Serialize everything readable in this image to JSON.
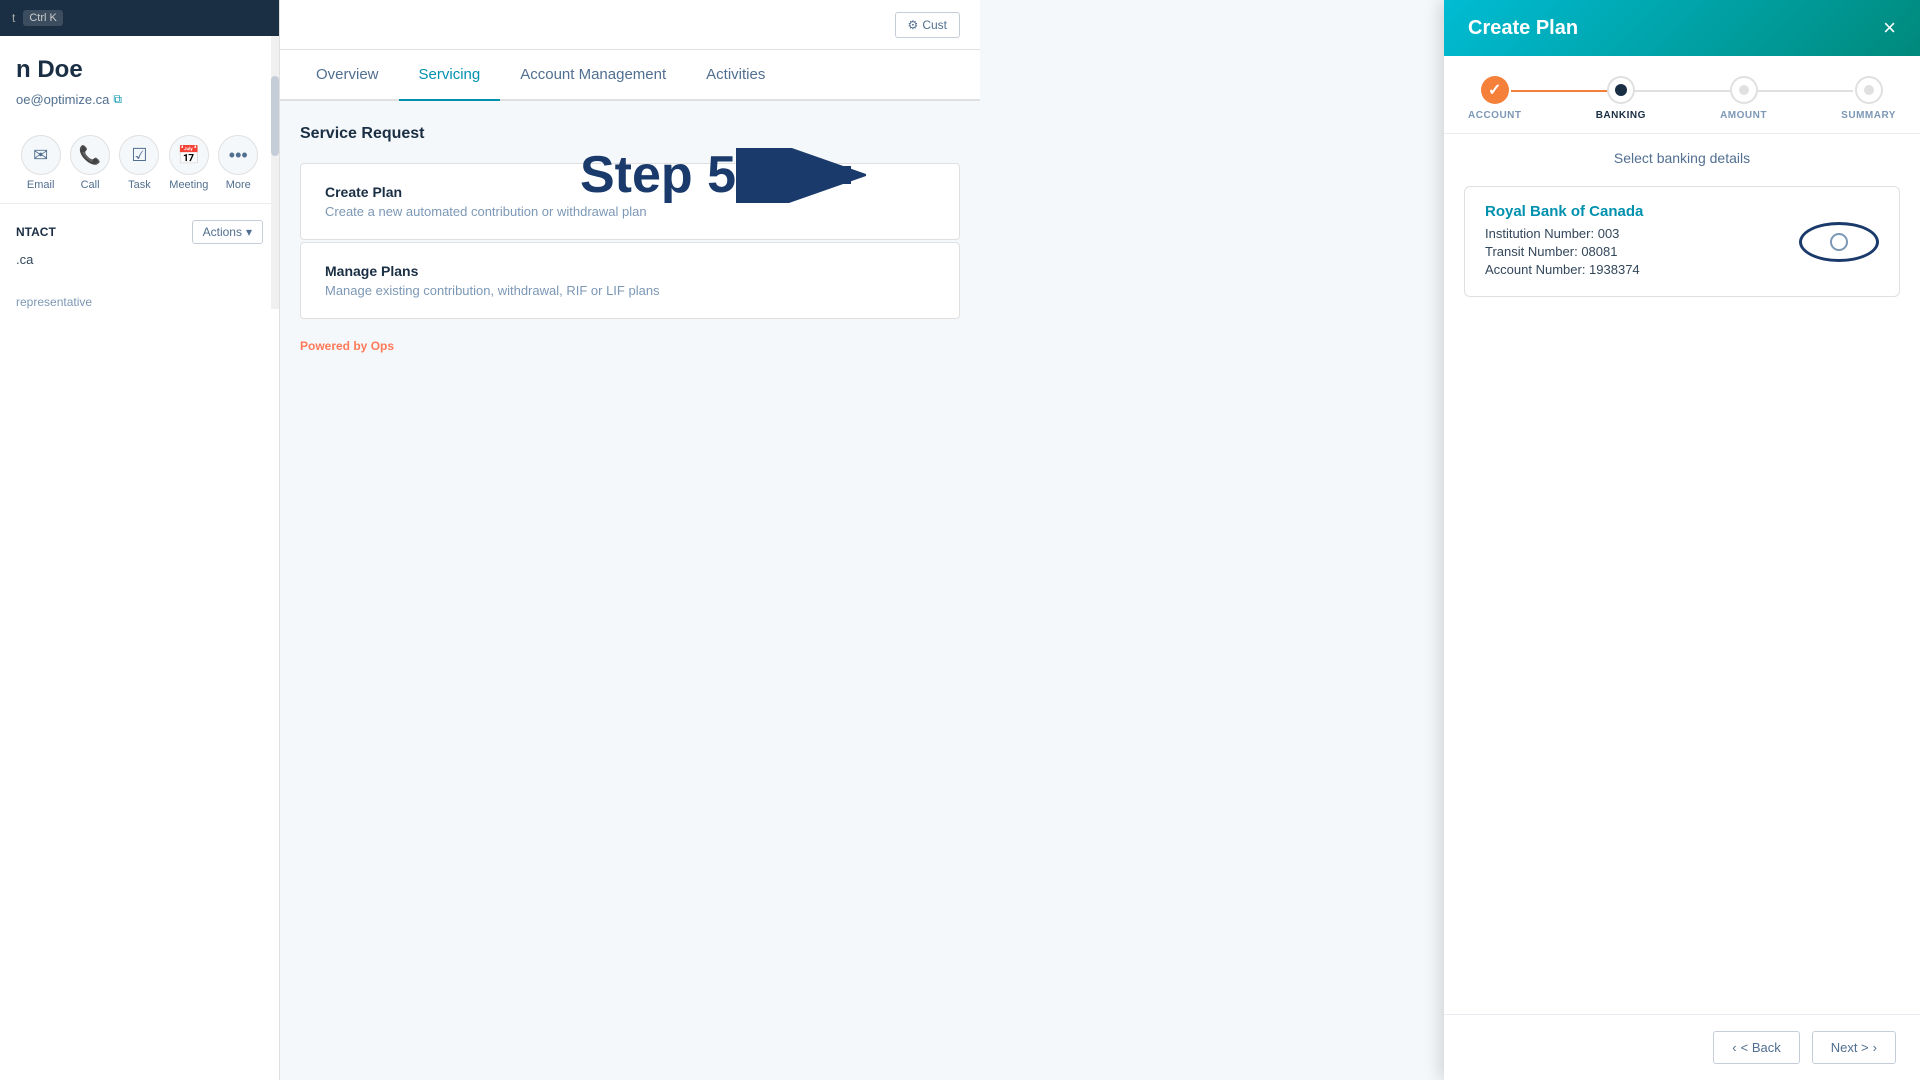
{
  "sidebar": {
    "search_hint": "Ctrl K",
    "contact_name": "n Doe",
    "contact_email": "oe@optimize.ca",
    "actions_label": "Actions",
    "action_icons": [
      {
        "id": "email",
        "icon": "✉",
        "label": "Email"
      },
      {
        "id": "call",
        "icon": "📞",
        "label": "Call"
      },
      {
        "id": "task",
        "icon": "📋",
        "label": "Task"
      },
      {
        "id": "meeting",
        "icon": "📅",
        "label": "Meeting"
      },
      {
        "id": "more",
        "icon": "•••",
        "label": "More"
      }
    ],
    "contact_section_title": "ntact",
    "contact_actions_btn": "Actions",
    "field1": ".ca",
    "rep_label": "representative"
  },
  "main": {
    "cust_btn": "Cust",
    "tabs": [
      {
        "id": "overview",
        "label": "Overview",
        "active": false
      },
      {
        "id": "servicing",
        "label": "Servicing",
        "active": true
      },
      {
        "id": "account-management",
        "label": "Account Management",
        "active": false
      },
      {
        "id": "activities",
        "label": "Activities",
        "active": false
      }
    ],
    "service_request_title": "Service Request",
    "cards": [
      {
        "id": "create-plan",
        "title": "Create Plan",
        "description": "Create a new automated contribution or withdrawal plan"
      },
      {
        "id": "manage-plans",
        "title": "Manage Plans",
        "description": "Manage existing contribution, withdrawal, RIF or LIF plans"
      }
    ],
    "powered_by_prefix": "Powered by ",
    "powered_by_brand": "Ops"
  },
  "step5": {
    "text": "Step 5"
  },
  "panel": {
    "title": "Create Plan",
    "close_label": "×",
    "subtitle": "Select banking details",
    "stepper": {
      "steps": [
        {
          "id": "account",
          "label": "ACCOUNT",
          "state": "completed"
        },
        {
          "id": "banking",
          "label": "BANKING",
          "state": "active"
        },
        {
          "id": "amount",
          "label": "AMOUNT",
          "state": "inactive"
        },
        {
          "id": "summary",
          "label": "SUMMARY",
          "state": "inactive"
        }
      ]
    },
    "bank": {
      "name": "Royal Bank of Canada",
      "institution": "Institution Number: 003",
      "transit": "Transit Number: 08081",
      "account": "Account Number: 1938374"
    },
    "footer": {
      "back_label": "< Back",
      "next_label": "Next >"
    }
  }
}
